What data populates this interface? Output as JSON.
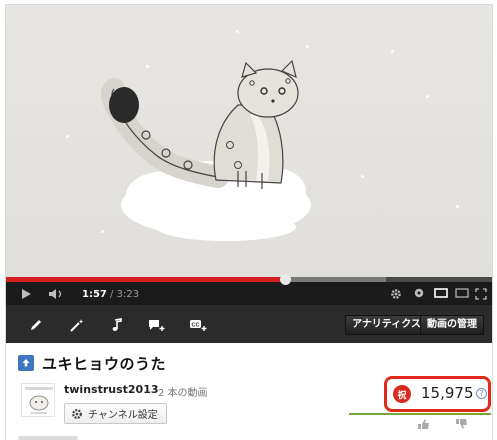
{
  "player": {
    "current_time": "1:57",
    "separator": " / ",
    "duration": "3:23",
    "progress_fraction": 0.576
  },
  "toolbar": {
    "analytics_label": "アナリティクス",
    "video_manager_label": "動画の管理"
  },
  "video": {
    "title": "ユキヒョウのうた"
  },
  "channel": {
    "name": "twinstrust2013",
    "video_count": "2 本の動画",
    "settings_label": "チャンネル設定"
  },
  "stats": {
    "views_badge": "祝",
    "view_count": "15,975",
    "help": "?"
  },
  "colors": {
    "progress": "#d61f1f",
    "highlight_border": "#e02b1c",
    "upload_blue": "#3f76c0"
  }
}
